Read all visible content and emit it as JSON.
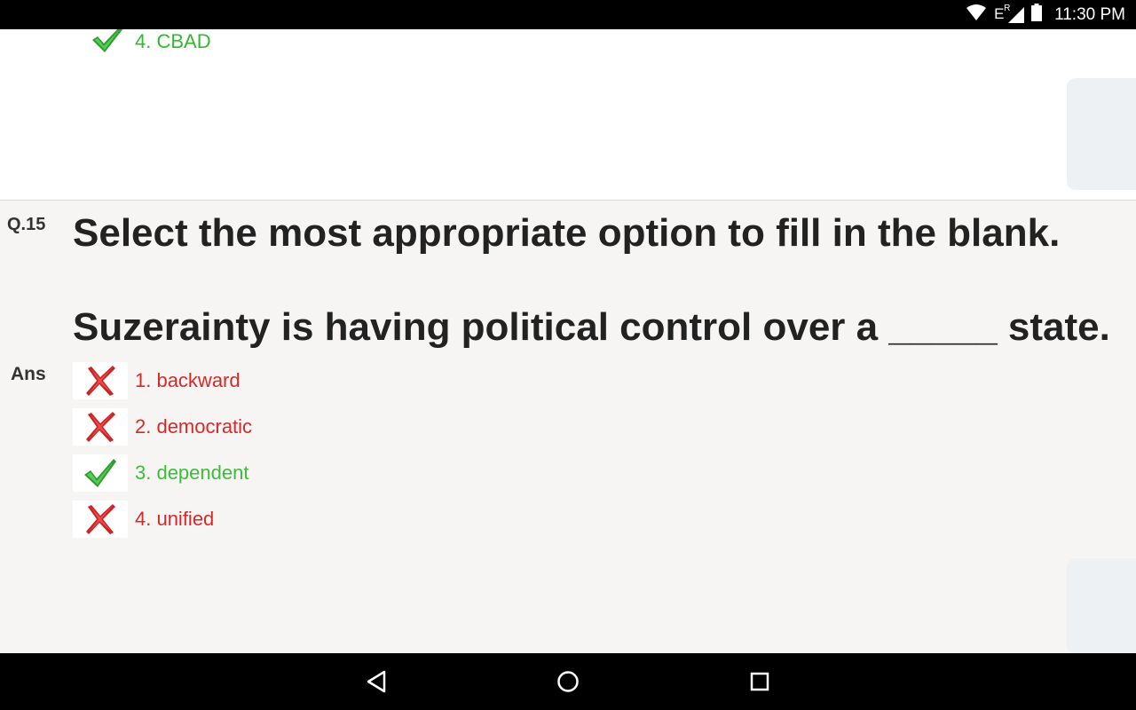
{
  "status_bar": {
    "time": "11:30 PM",
    "network_label": "E",
    "network_superscript": "R"
  },
  "previous_question": {
    "last_option": {
      "label": "4. CBAD",
      "status": "correct"
    }
  },
  "question": {
    "number": "Q.15",
    "prompt": "Select the most appropriate option to fill in the blank.",
    "sentence": "Suzerainty is having political control over a _____ state.",
    "answer_label": "Ans",
    "options": [
      {
        "label": "1. backward",
        "status": "wrong"
      },
      {
        "label": "2. democratic",
        "status": "wrong"
      },
      {
        "label": "3. dependent",
        "status": "correct"
      },
      {
        "label": "4. unified",
        "status": "wrong"
      }
    ]
  },
  "colors": {
    "correct": "#3bbd3b",
    "wrong": "#d62a2a",
    "question_bg": "#f6f5f3",
    "side_tab": "#edf1f4"
  },
  "icons": {
    "status": [
      "wifi-icon",
      "cell-signal-icon",
      "battery-icon"
    ],
    "marks": [
      "check-icon",
      "cross-icon"
    ],
    "nav": [
      "back-icon",
      "home-icon",
      "recents-icon"
    ]
  }
}
